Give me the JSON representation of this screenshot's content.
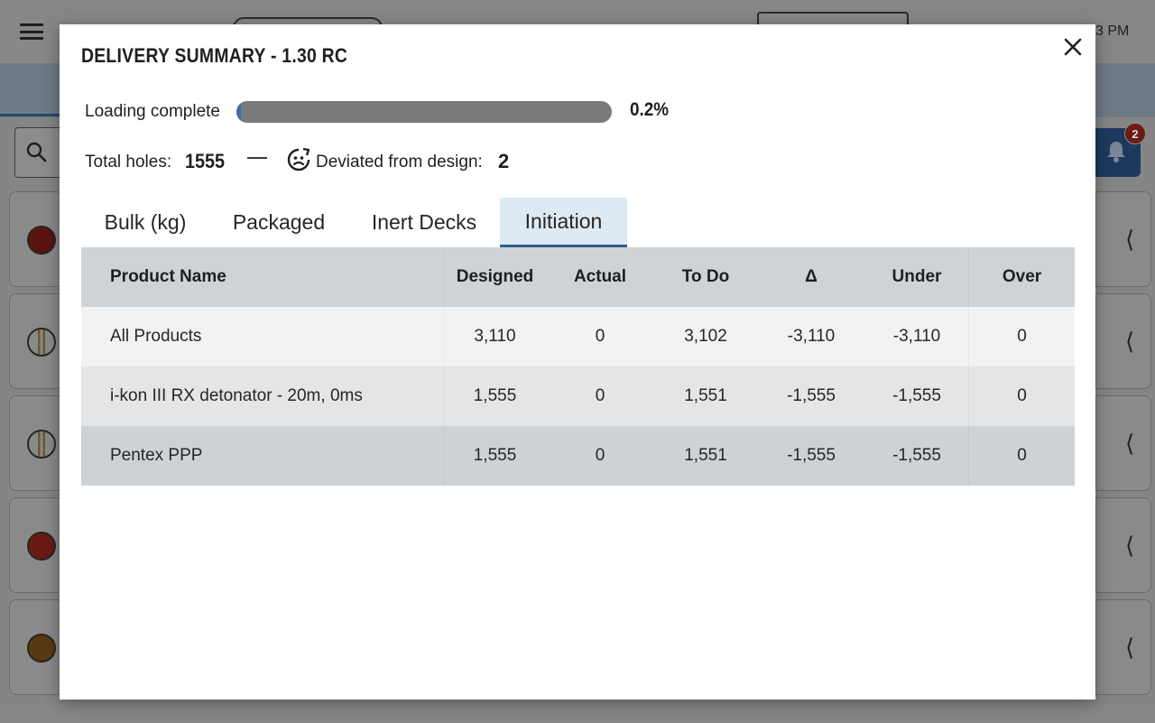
{
  "background": {
    "time_fragment": "3 PM",
    "notification_count": "2"
  },
  "modal": {
    "title": "DELIVERY SUMMARY - 1.30 RC",
    "loading": {
      "label": "Loading complete",
      "percent": 0.2,
      "percent_text": "0.2%"
    },
    "stats": {
      "total_holes_label": "Total holes:",
      "total_holes_value": "1555",
      "deviated_label": "Deviated from design:",
      "deviated_value": "2"
    },
    "tabs": [
      {
        "label": "Bulk (kg)",
        "active": false
      },
      {
        "label": "Packaged",
        "active": false
      },
      {
        "label": "Inert Decks",
        "active": false
      },
      {
        "label": "Initiation",
        "active": true
      }
    ],
    "table": {
      "columns": [
        "Product Name",
        "Designed",
        "Actual",
        "To Do",
        "Δ",
        "Under",
        "Over"
      ],
      "rows": [
        [
          "All Products",
          "3,110",
          "0",
          "3,102",
          "-3,110",
          "-3,110",
          "0"
        ],
        [
          "i-kon III RX detonator - 20m, 0ms",
          "1,555",
          "0",
          "1,551",
          "-1,555",
          "-1,555",
          "0"
        ],
        [
          "Pentex PPP",
          "1,555",
          "0",
          "1,551",
          "-1,555",
          "-1,555",
          "0"
        ]
      ]
    }
  },
  "colors": {
    "progress_fill": "#3e6f9d",
    "progress_track": "#7a7a7a",
    "active_tab_bg": "#dde9f3",
    "active_tab_underline": "#2f5f8f",
    "header_bg": "#ced3d8"
  }
}
